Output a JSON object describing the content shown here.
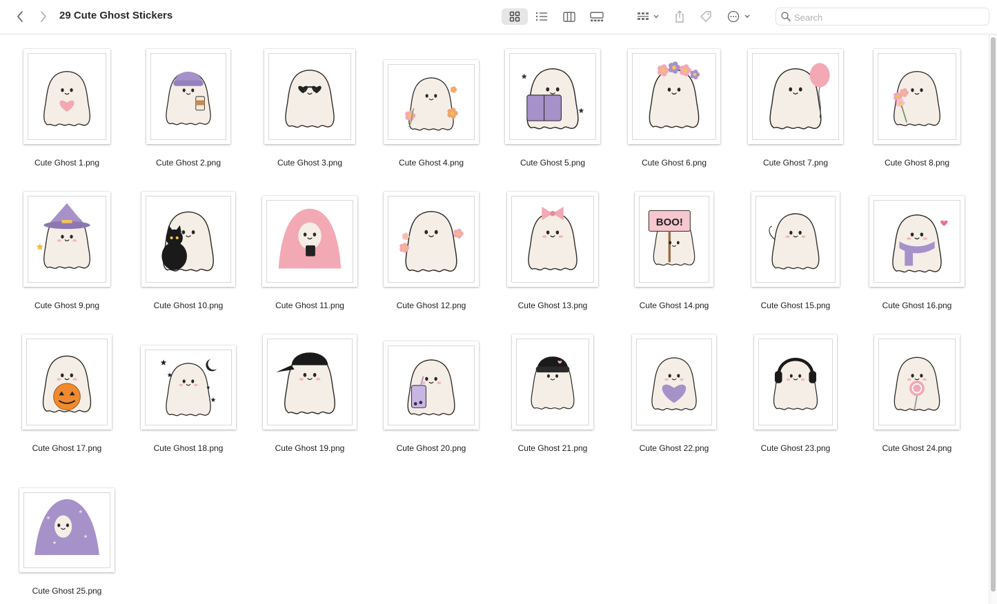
{
  "window": {
    "title": "29 Cute Ghost Stickers",
    "search_placeholder": "Search"
  },
  "toolbar": {
    "back_icon": "chevron-left-icon",
    "forward_icon": "chevron-right-icon",
    "view_modes": [
      "icon-view",
      "list-view",
      "column-view",
      "gallery-view"
    ],
    "active_view": "icon-view",
    "group_icon": "group-by-icon",
    "share_icon": "share-icon",
    "tag_icon": "tag-icon",
    "more_icon": "more-actions-icon"
  },
  "colors": {
    "ghost_body": "#f4eee6",
    "outline": "#2b2724",
    "blush": "#f3b7b7",
    "purple": "#a791c9",
    "pink": "#f2a9b3",
    "orange": "#ef8a2e",
    "selection_bg": "#e6e6e6"
  },
  "files": [
    {
      "name": "Cute Ghost 1.png",
      "icon": "ghost-holding-heart-icon"
    },
    {
      "name": "Cute Ghost 2.png",
      "icon": "ghost-beanie-coffee-icon"
    },
    {
      "name": "Cute Ghost 3.png",
      "icon": "ghost-heart-sunglasses-icon"
    },
    {
      "name": "Cute Ghost 4.png",
      "icon": "ghost-flowers-icon"
    },
    {
      "name": "Cute Ghost 5.png",
      "icon": "ghost-reading-book-icon"
    },
    {
      "name": "Cute Ghost 6.png",
      "icon": "ghost-flower-crown-icon"
    },
    {
      "name": "Cute Ghost 7.png",
      "icon": "ghost-balloon-icon"
    },
    {
      "name": "Cute Ghost 8.png",
      "icon": "ghost-bouquet-icon"
    },
    {
      "name": "Cute Ghost 9.png",
      "icon": "ghost-witch-hat-icon"
    },
    {
      "name": "Cute Ghost 10.png",
      "icon": "ghost-black-cat-icon"
    },
    {
      "name": "Cute Ghost 11.png",
      "icon": "ghost-pink-blanket-icon"
    },
    {
      "name": "Cute Ghost 12.png",
      "icon": "ghost-floral-icon"
    },
    {
      "name": "Cute Ghost 13.png",
      "icon": "ghost-pink-bow-icon"
    },
    {
      "name": "Cute Ghost 14.png",
      "icon": "ghost-boo-sign-icon"
    },
    {
      "name": "Cute Ghost 15.png",
      "icon": "ghost-waving-icon"
    },
    {
      "name": "Cute Ghost 16.png",
      "icon": "ghost-scarf-icon"
    },
    {
      "name": "Cute Ghost 17.png",
      "icon": "ghost-pumpkin-icon"
    },
    {
      "name": "Cute Ghost 18.png",
      "icon": "ghost-moon-stars-icon"
    },
    {
      "name": "Cute Ghost 19.png",
      "icon": "ghost-cap-icon"
    },
    {
      "name": "Cute Ghost 20.png",
      "icon": "ghost-boba-tea-icon"
    },
    {
      "name": "Cute Ghost 21.png",
      "icon": "ghost-black-beanie-icon"
    },
    {
      "name": "Cute Ghost 22.png",
      "icon": "ghost-purple-heart-icon"
    },
    {
      "name": "Cute Ghost 23.png",
      "icon": "ghost-headphones-icon"
    },
    {
      "name": "Cute Ghost 24.png",
      "icon": "ghost-lollipop-icon"
    },
    {
      "name": "Cute Ghost 25.png",
      "icon": "ghost-star-blanket-icon"
    }
  ]
}
